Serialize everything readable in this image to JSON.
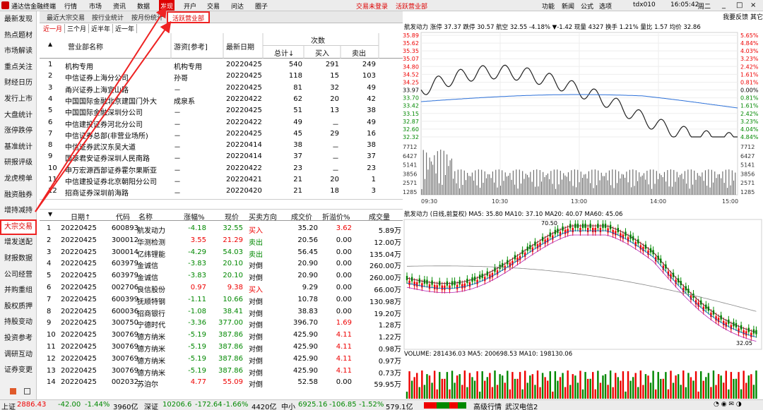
{
  "menubar": {
    "app_title": "通达信金融终端",
    "menus": [
      "行情",
      "市场",
      "资讯",
      "数据",
      "发现",
      "开户",
      "交易",
      "问达",
      "圈子"
    ],
    "active_menu": "发现",
    "notice_1": "交易未登录",
    "notice_2": "活跃营业部",
    "right_items": [
      "功能",
      "新闻",
      "公式",
      "选项"
    ],
    "account": "tdx010",
    "time": "16:05:42",
    "weekday": "周二"
  },
  "leftnav": {
    "items": [
      "最新发现",
      "热点题材",
      "市场解读",
      "重点关注",
      "财经日历",
      "发行上市",
      "大盘统计",
      "涨停跌停",
      "基准统计",
      "研报评级",
      "龙虎榜单",
      "融资融券",
      "增持减持",
      "大宗交易",
      "增发送配",
      "财报数据",
      "公司经营",
      "并购重组",
      "股权质押",
      "持股变动",
      "投资参考",
      "调研互动",
      "证券变更"
    ],
    "active": "大宗交易"
  },
  "subtabs": {
    "items": [
      "最近大宗交易",
      "按行业统计",
      "按月份统计",
      "活跃营业部"
    ],
    "active": "活跃营业部"
  },
  "periodtabs": {
    "items": [
      "近一月",
      "三个月",
      "近半年",
      "近一年"
    ],
    "active": "近一月"
  },
  "top_table": {
    "headers": {
      "name": "营业部名称",
      "alias": "游资[参考]",
      "date": "最新日期",
      "group": "次数",
      "total": "总计↓",
      "buy": "买入",
      "sell": "卖出"
    },
    "rows": [
      [
        "1",
        "机构专用",
        "机构专用",
        "20220425",
        "540",
        "291",
        "249"
      ],
      [
        "2",
        "中信证券上海分公司",
        "孙哥",
        "20220425",
        "118",
        "15",
        "103"
      ],
      [
        "3",
        "甬兴证券上海宜山路",
        "－",
        "20220425",
        "81",
        "32",
        "49"
      ],
      [
        "4",
        "中国国际金融北京建国门外大",
        "成泉系",
        "20220422",
        "62",
        "20",
        "42"
      ],
      [
        "5",
        "中国国际金融深圳分公司",
        "－",
        "20220425",
        "51",
        "13",
        "38"
      ],
      [
        "6",
        "中信建投证券河北分公司",
        "－",
        "20220422",
        "49",
        "－",
        "49"
      ],
      [
        "7",
        "中信证券总部(非营业场所)",
        "－",
        "20220425",
        "45",
        "29",
        "16"
      ],
      [
        "8",
        "中信证券武汉东吴大道",
        "－",
        "20220414",
        "38",
        "－",
        "38"
      ],
      [
        "9",
        "国泰君安证券深圳人民南路",
        "－",
        "20220414",
        "37",
        "－",
        "37"
      ],
      [
        "10",
        "申万宏源西部证券霍尔果斯亚",
        "－",
        "20220422",
        "23",
        "－",
        "23"
      ],
      [
        "11",
        "中信建投证券北京朝阳分公司",
        "－",
        "20220421",
        "21",
        "20",
        "1"
      ],
      [
        "12",
        "招商证券深圳前海路",
        "－",
        "20220420",
        "21",
        "18",
        "3"
      ]
    ]
  },
  "bottom_table": {
    "headers": {
      "date": "日期↑",
      "code": "代码",
      "name": "名称",
      "chg": "涨幅%",
      "price": "现价",
      "dir": "买卖方向",
      "deal": "成交价",
      "prem": "折溢价%",
      "vol": "成交量"
    },
    "rows": [
      [
        "1",
        "20220425",
        "600893",
        "航发动力",
        "-4.18",
        "32.55",
        "买入",
        "35.20",
        "3.62",
        "5.89万"
      ],
      [
        "2",
        "20220425",
        "300012",
        "华测检测",
        "3.55",
        "21.29",
        "卖出",
        "20.56",
        "0.00",
        "12.00万"
      ],
      [
        "3",
        "20220425",
        "300014",
        "亿纬锂能",
        "-4.29",
        "54.03",
        "卖出",
        "56.45",
        "0.00",
        "135.04万"
      ],
      [
        "4",
        "20220425",
        "603979",
        "金诚信",
        "-3.83",
        "20.10",
        "对倒",
        "20.90",
        "0.00",
        "260.00万"
      ],
      [
        "5",
        "20220425",
        "603979",
        "金诚信",
        "-3.83",
        "20.10",
        "对倒",
        "20.90",
        "0.00",
        "260.00万"
      ],
      [
        "6",
        "20220425",
        "002706",
        "良信股份",
        "0.97",
        "9.38",
        "买入",
        "9.29",
        "0.00",
        "66.00万"
      ],
      [
        "7",
        "20220425",
        "600399",
        "抚顺特钢",
        "-1.11",
        "10.66",
        "对倒",
        "10.78",
        "0.00",
        "130.98万"
      ],
      [
        "8",
        "20220425",
        "600036",
        "招商银行",
        "-1.08",
        "38.41",
        "对倒",
        "38.83",
        "0.00",
        "19.20万"
      ],
      [
        "9",
        "20220425",
        "300750",
        "宁德时代",
        "-3.36",
        "377.00",
        "对倒",
        "396.70",
        "1.69",
        "1.28万"
      ],
      [
        "10",
        "20220425",
        "300769",
        "德方纳米",
        "-5.19",
        "387.86",
        "对倒",
        "425.90",
        "4.11",
        "1.22万"
      ],
      [
        "11",
        "20220425",
        "300769",
        "德方纳米",
        "-5.19",
        "387.86",
        "对倒",
        "425.90",
        "4.11",
        "0.98万"
      ],
      [
        "12",
        "20220425",
        "300769",
        "德方纳米",
        "-5.19",
        "387.86",
        "对倒",
        "425.90",
        "4.11",
        "0.97万"
      ],
      [
        "13",
        "20220425",
        "300769",
        "德方纳米",
        "-5.19",
        "387.86",
        "对倒",
        "425.90",
        "4.11",
        "0.73万"
      ],
      [
        "14",
        "20220425",
        "002032",
        "苏泊尔",
        "4.77",
        "55.09",
        "对倒",
        "52.58",
        "0.00",
        "59.95万"
      ]
    ]
  },
  "top_right": {
    "item_1": "我要反馈",
    "item_2": "其它"
  },
  "intraday": {
    "header": "航发动力  涨停 37.37  跌停 30.57  航空 32.55 -4.18%  ▼-1.42  现量 4327  换手 1.21%  量比 1.57  均价 32.86",
    "left_ticks": [
      "35.89",
      "35.62",
      "35.35",
      "35.07",
      "34.80",
      "34.52",
      "34.25",
      "33.97",
      "33.70",
      "33.42",
      "33.15",
      "32.87",
      "32.60",
      "32.32"
    ],
    "right_ticks": [
      "5.65%",
      "4.84%",
      "4.03%",
      "3.23%",
      "2.42%",
      "1.61%",
      "0.81%",
      "0.00%",
      "0.81%",
      "1.61%",
      "2.42%",
      "3.23%",
      "4.04%",
      "4.84%"
    ],
    "vol_ticks": [
      "7712",
      "6427",
      "5141",
      "3856",
      "2571",
      "1285"
    ],
    "time_ticks": [
      "09:30",
      "10:30",
      "13:00",
      "14:00",
      "15:00"
    ]
  },
  "kline": {
    "header": "航发动力 (日线,前复权)  MA5: 35.80  MA10: 37.10  MA20: 40.07  MA60: 45.06",
    "high_label": "70.50",
    "low_label": "32.05"
  },
  "volume": {
    "header": "VOLUME: 281436.03  MA5: 200698.53  MA10: 198130.06"
  },
  "statusbar": {
    "sh_label": "上证",
    "sh_value": "2886.43",
    "sh_chg": "-42.00",
    "sh_pct": "-1.44%",
    "sh_amt": "3960亿",
    "sz_label": "深证",
    "sz_value": "10206.6",
    "sz_chg": "-172.64",
    "sz_pct": "-1.66%",
    "sz_amt": "4420亿",
    "zx_label": "中小",
    "zx_value": "6925.16",
    "zx_chg": "-106.85",
    "zx_pct": "-1.52%",
    "zx_amt": "579.1亿",
    "feed": "高级行情_武汉电信2"
  },
  "colors": {
    "up": "#e00000",
    "down": "#008000",
    "highlight": "#e22222"
  }
}
